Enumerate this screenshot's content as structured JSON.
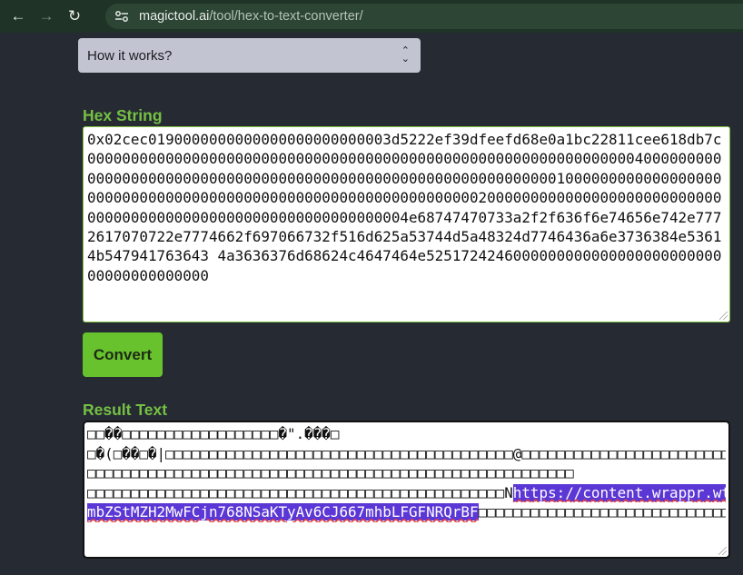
{
  "browser": {
    "url_domain": "magictool.ai",
    "url_path": "/tool/hex-to-text-converter/"
  },
  "how_it_works": {
    "label": "How it works?"
  },
  "hex_section": {
    "label": "Hex String",
    "value": "0x02cec0190000000000000000000000003d5222ef39dfeefd68e0a1bc22811cee618db7c0000000000000000000000000000000000000000000000000000000000000004000000000000000000000000000000000000000000000000000000000000000100000000000000000000000000000000000000000000000000000000000000020000000000000000000000000000000000000000000000000000000000000004e68747470733a2f2f636f6e74656e742e7772617070722e7774662f697066732f516d625a53744d5a48324d7746436a6e3736384e53614b547941763643 4a3636376d68624c4647464e525172424600000000000000000000000000000000000000"
  },
  "convert_button": {
    "label": "Convert"
  },
  "result_section": {
    "label": "Result Text",
    "line1": "□□��□□□□□□□□□□□□□□□□□□�\".���□",
    "line2": "□�(□��□�|□□□□□□□□□□□□□□□□□□□□□□□□□□□□□□□□□□□□□□□□@□□□□□□□□□□□□□□□□□□□□□□□□□□□□□□□□□",
    "line3": "□□□□□□□□□□□□□□□□□□□□□□□□□□□□□□□□□□□□□□□□□□□□□□□□□□□□□□□□",
    "line4_prefix": "□□□□□□□□□□□□□□□□□□□□□□□□□□□□□□□□□□□□□□□□□□□□□□□□N",
    "line4_url": "https://content.wrappr.wtf/ipfs/Q",
    "line5_url": "mbZStMZH2MwFCjn768NSaKTyAv6CJ667mhbLFGFNRQrBF",
    "line5_suffix": "□□□□□□□□□□□□□□□□□□□□□□□□□□□□□□□□□"
  }
}
